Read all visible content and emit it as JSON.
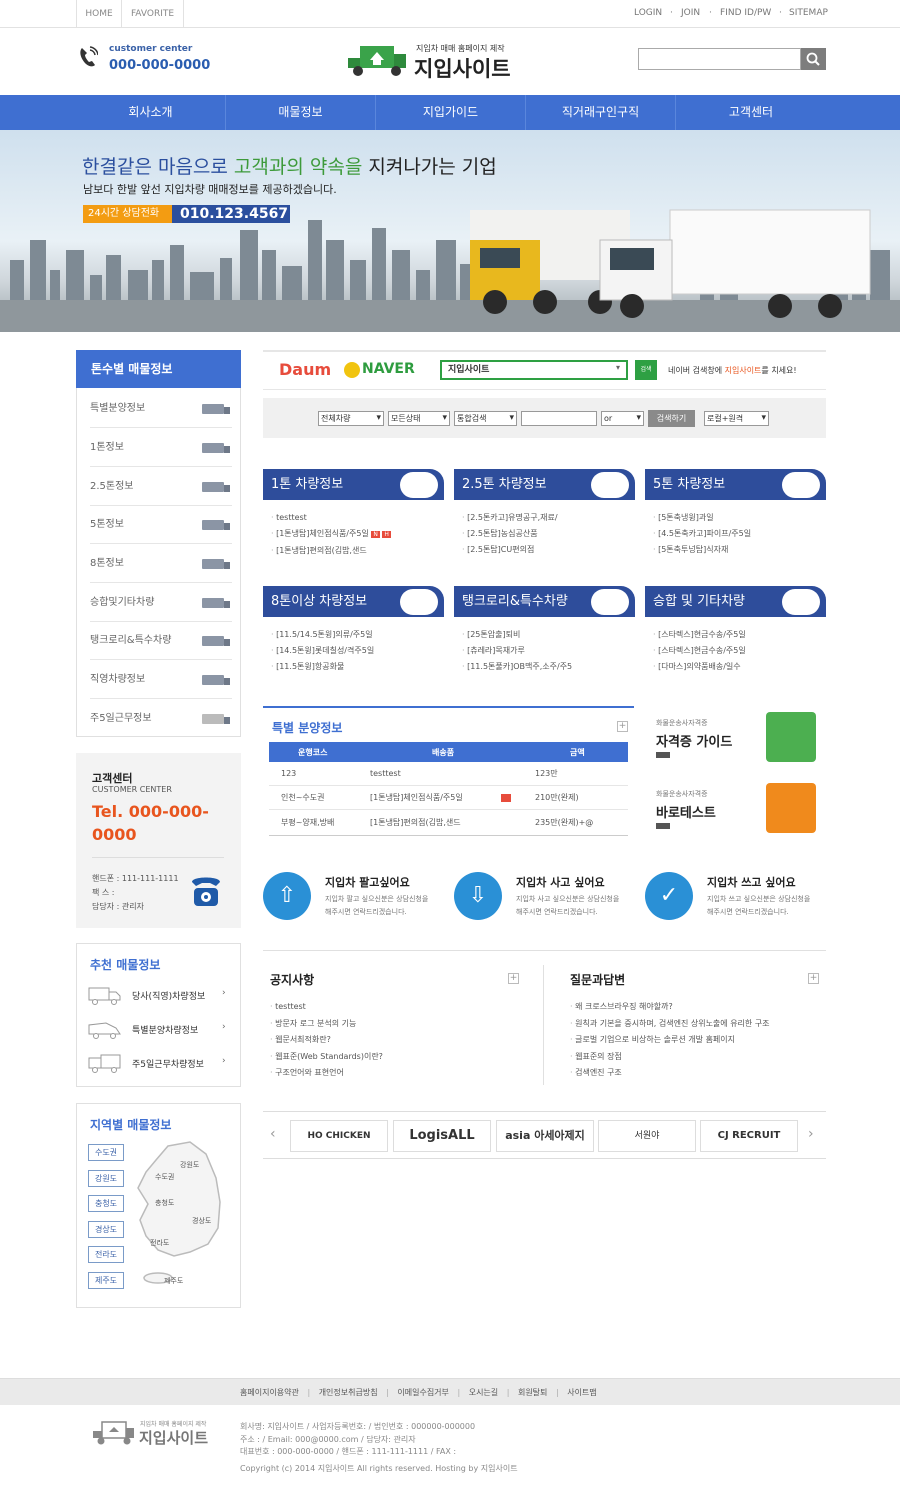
{
  "topbar": {
    "home": "HOME",
    "favorite": "FAVORITE",
    "login": "LOGIN",
    "join": "JOIN",
    "find": "FIND ID/PW",
    "sitemap": "SITEMAP"
  },
  "header": {
    "cc_label": "customer center",
    "cc_phone": "000-000-0000",
    "logo_sub": "지입차 매매 홈페이지 제작",
    "logo_main": "지입사이트",
    "search_placeholder": ""
  },
  "nav": [
    "회사소개",
    "매물정보",
    "지입가이드",
    "직거래구인구직",
    "고객센터"
  ],
  "banner": {
    "headline_a": "한결같은 마음으로 ",
    "headline_b": "고객과의 약속을",
    "headline_c": " 지켜나가는 기업",
    "sub": "남보다 한발 앞선 지입차량 매매정보를 제공하겠습니다.",
    "tag": "24시간 상담전화",
    "phone": "010.123.4567"
  },
  "sidebar": {
    "ton_title": "톤수별 매물정보",
    "ton_items": [
      "특별분양정보",
      "1톤정보",
      "2.5톤정보",
      "5톤정보",
      "8톤정보",
      "승합및기타차량",
      "탱크로리&특수차량",
      "직영차량정보",
      "주5일근무정보"
    ],
    "cs_title": "고객센터",
    "cs_en": "CUSTOMER CENTER",
    "cs_tel1": "Tel. 000-000-",
    "cs_tel2": "0000",
    "cs_hand": "핸드폰 : 111-111-1111",
    "cs_fax": "팩    스 :",
    "cs_manager": "담당자 : 관리자",
    "rec_title": "추천 매물정보",
    "rec_items": [
      "당사(직영)차량정보",
      "특별분양차량정보",
      "주5일근무차량정보"
    ],
    "region_title": "지역별 매물정보",
    "regions": [
      "수도권",
      "강원도",
      "충청도",
      "경상도",
      "전라도",
      "제주도"
    ],
    "map_labels": [
      "강원도",
      "수도권",
      "충청도",
      "경상도",
      "전라도",
      "제주도"
    ]
  },
  "searchbar": {
    "daum": "Daum",
    "naver": "NAVER",
    "query": "지입사이트",
    "go": "검색",
    "hint_a": "네이버 검색창에 ",
    "hint_b": "지입사이트",
    "hint_c": "를 치세요!"
  },
  "filter": {
    "s1": "전체차량",
    "s2": "모든상태",
    "s3": "통합검색",
    "s4": "or",
    "btn": "검색하기",
    "s5": "로컬+원격"
  },
  "panels": [
    {
      "title": "1톤 차량정보",
      "items": [
        "testtest",
        "[1톤냉탑]체인점식품/주5일",
        "[1톤냉탑]편의점(김밥,샌드"
      ]
    },
    {
      "title": "2.5톤 차량정보",
      "items": [
        "[2.5톤카고]유명공구,재료/",
        "[2.5톤탑]농심공산품",
        "[2.5톤탑]CU편의점"
      ]
    },
    {
      "title": "5톤 차량정보",
      "items": [
        "[5톤축냉윙]과일",
        "[4.5톤축카고]파이프/주5일",
        "[5톤축투넝탑]식자재"
      ]
    },
    {
      "title": "8톤이상 차량정보",
      "items": [
        "[11.5/14.5톤윙]의류/주5일",
        "[14.5톤윙]롯데칠성/격주5일",
        "[11.5톤윙]항공화물"
      ]
    },
    {
      "title": "탱크로리&특수차량",
      "items": [
        "[25톤압출]퇴비",
        "[츄레라]목재가루",
        "[11.5톤풀카]OB맥주,소주/주5"
      ]
    },
    {
      "title": "승합 및 기타차량",
      "items": [
        "[스타렉스]현금수송/주5일",
        "[스타렉스]현금수송/주5일",
        "[다마스]의약품배송/일수"
      ]
    }
  ],
  "special": {
    "title": "특별 분양정보",
    "cols": [
      "운행코스",
      "배송품",
      "금액"
    ],
    "rows": [
      [
        "123",
        "testtest",
        "123만"
      ],
      [
        "인천~수도권",
        "[1톤냉탑]체인점식품/주5일",
        "210만(완제)"
      ],
      [
        "부평~양재,방배",
        "[1톤냉탑]편의점(김밥,샌드",
        "235만(완제)+@"
      ]
    ]
  },
  "guides": [
    {
      "small": "화물운송사자격증",
      "big": "자격증 가이드"
    },
    {
      "small": "화물운송사자격증",
      "big": "바로테스트"
    }
  ],
  "actions": [
    {
      "title": "지입차 팔고싶어요",
      "d1": "지입차 팔고 싶으신분은 상담신청을",
      "d2": "해주시면 연락드리겠습니다."
    },
    {
      "title": "지입차 사고 싶어요",
      "d1": "지입차 사고 싶으신분은 상담신청을",
      "d2": "해주시면 연락드리겠습니다."
    },
    {
      "title": "지입차 쓰고 싶어요",
      "d1": "지입차 쓰고 싶으신분은 상담신청을",
      "d2": "해주시면 연락드리겠습니다."
    }
  ],
  "notice": {
    "title": "공지사항",
    "items": [
      "testtest",
      "방문자 로그 분석의 기능",
      "웹문서최적화란?",
      "웹표준(Web Standards)이란?",
      "구조언어와 표현언어"
    ]
  },
  "qna": {
    "title": "질문과답변",
    "items": [
      "왜 크로스브라우징 해야할까?",
      "원칙과 기본을 중시하며, 검색엔진 상위노출에 유리한 구조",
      "글로벌 기업으로 비상하는 솔루션 개발 홈페이지",
      "웹표준의 장점",
      "검색엔진 구조"
    ]
  },
  "partners": [
    "HO CHICKEN",
    "LogisALL",
    "asia 아세아제지",
    "서원야",
    "CJ RECRUIT"
  ],
  "footer": {
    "links": [
      "홈페이지이용약관",
      "개인정보취급방침",
      "이메일수집거부",
      "오시는길",
      "회원탈퇴",
      "사이트맵"
    ],
    "logo_sub": "지입차 매매 홈페이지 제작",
    "logo_main": "지입사이트",
    "l1": "회사명: 지입사이트 / 사업자등록번호: / 법인번호 : 000000-000000",
    "l2": "주소 : / Email: 000@0000.com / 담당자: 관리자",
    "l3": "대표번호 : 000-000-0000 / 핸드폰 : 111-111-1111 / FAX :",
    "l4": "Copyright (c) 2014 지입사이트 All rights reserved. Hosting by 지입사이트"
  }
}
